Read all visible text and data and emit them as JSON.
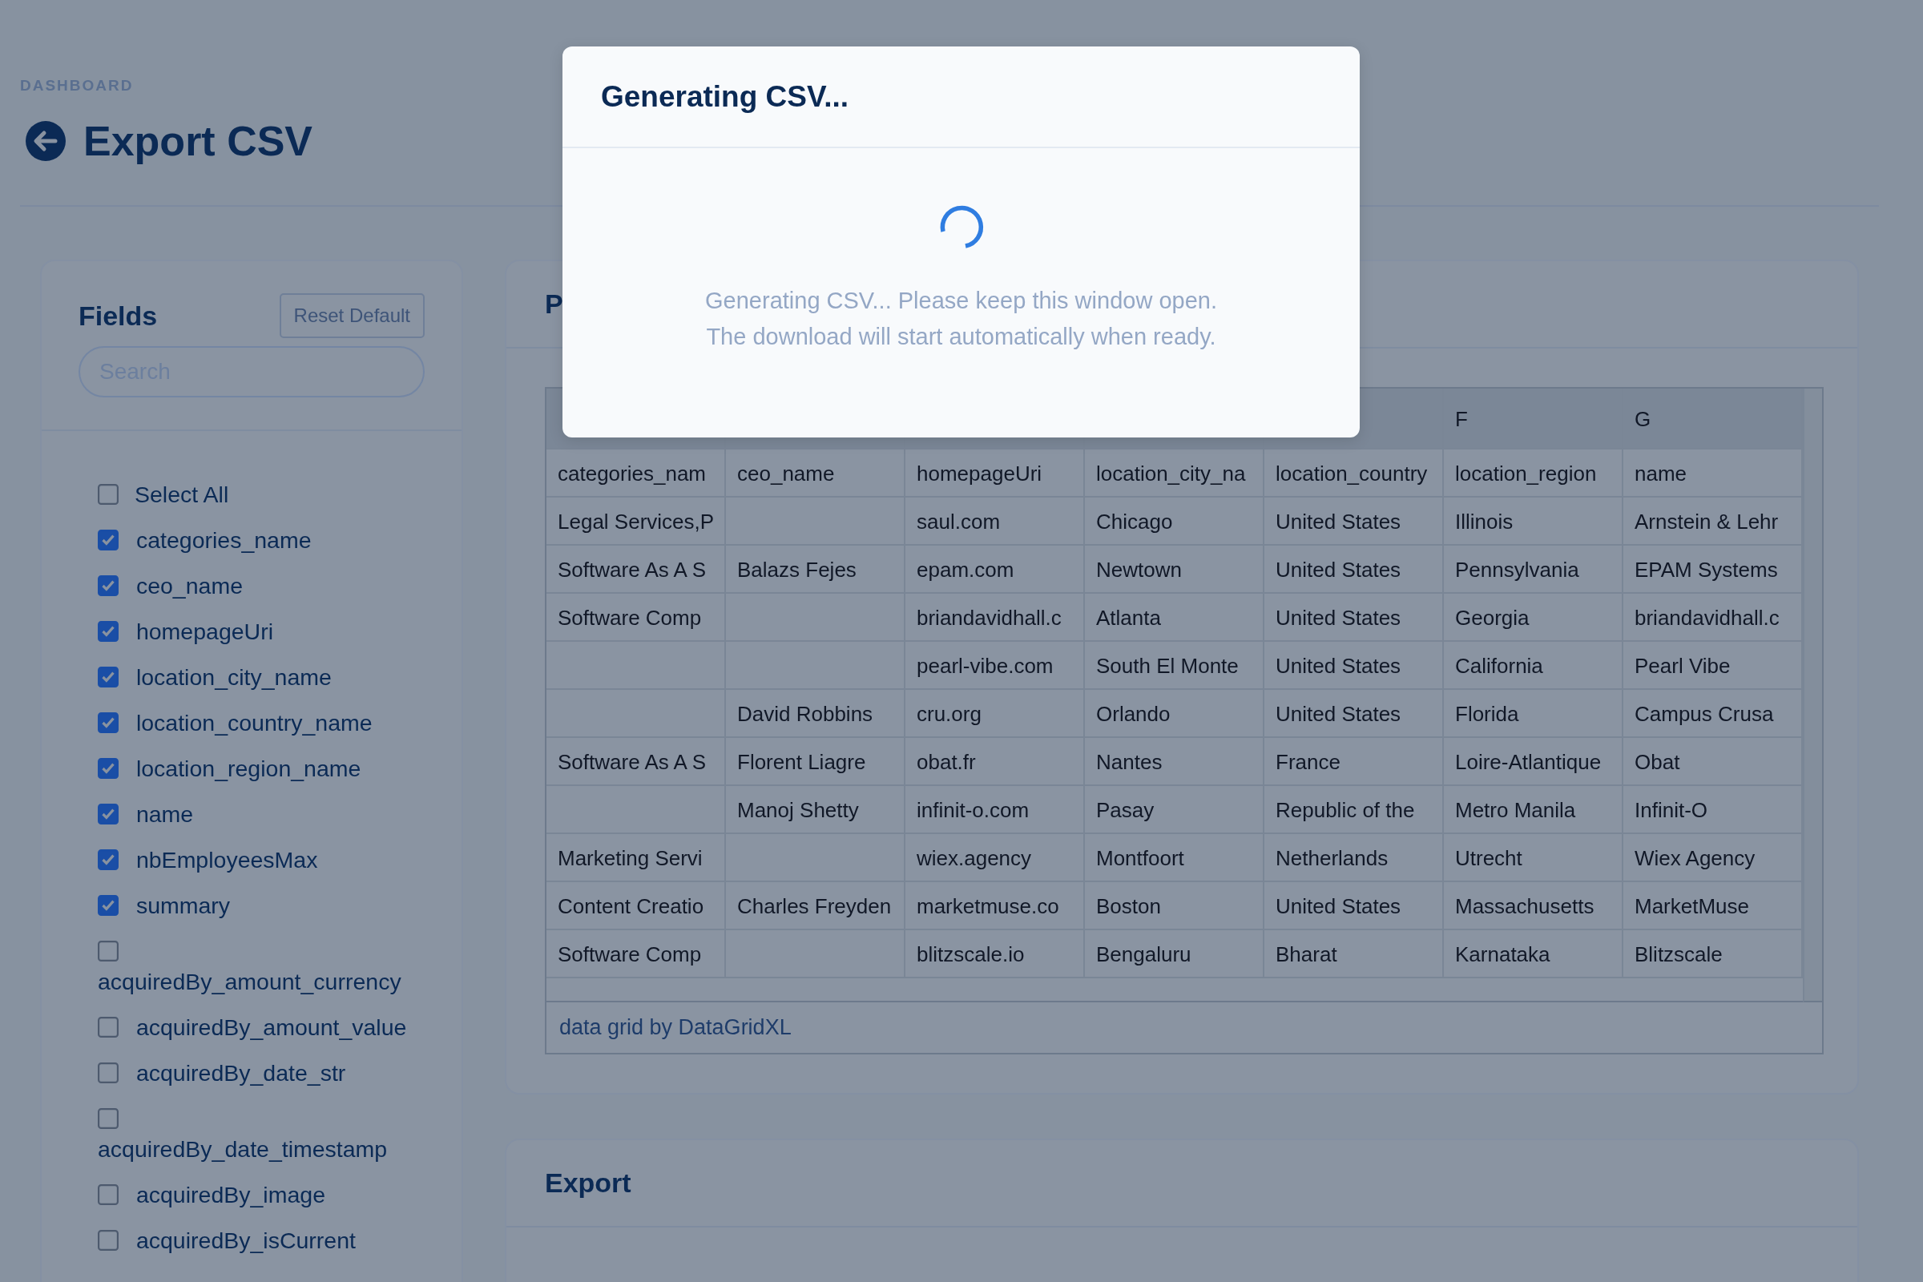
{
  "breadcrumb": "DASHBOARD",
  "title": "Export CSV",
  "fields_panel": {
    "title": "Fields",
    "reset_button": "Reset Default",
    "search": {
      "placeholder": "Search"
    },
    "select_all": {
      "label": "Select All",
      "checked": false
    },
    "items": [
      {
        "label": "categories_name",
        "checked": true
      },
      {
        "label": "ceo_name",
        "checked": true
      },
      {
        "label": "homepageUri",
        "checked": true
      },
      {
        "label": "location_city_name",
        "checked": true
      },
      {
        "label": "location_country_name",
        "checked": true
      },
      {
        "label": "location_region_name",
        "checked": true
      },
      {
        "label": "name",
        "checked": true
      },
      {
        "label": "nbEmployeesMax",
        "checked": true
      },
      {
        "label": "summary",
        "checked": true
      },
      {
        "label": "acquiredBy_amount_currency",
        "checked": false
      },
      {
        "label": "acquiredBy_amount_value",
        "checked": false
      },
      {
        "label": "acquiredBy_date_str",
        "checked": false
      },
      {
        "label": "acquiredBy_date_timestamp",
        "checked": false
      },
      {
        "label": "acquiredBy_image",
        "checked": false
      },
      {
        "label": "acquiredBy_isCurrent",
        "checked": false
      }
    ]
  },
  "preview_panel": {
    "title": "P",
    "grid": {
      "visible_headers": [
        "F",
        "G"
      ],
      "rows": [
        [
          "categories_nam",
          "ceo_name",
          "homepageUri",
          "location_city_na",
          "location_country",
          "location_region",
          "name"
        ],
        [
          "Legal Services,P",
          null,
          "saul.com",
          "Chicago",
          "United States",
          "Illinois",
          "Arnstein & Lehr"
        ],
        [
          "Software As A S",
          "Balazs Fejes",
          "epam.com",
          "Newtown",
          "United States",
          "Pennsylvania",
          "EPAM Systems"
        ],
        [
          "Software Comp",
          null,
          "briandavidhall.c",
          "Atlanta",
          "United States",
          "Georgia",
          "briandavidhall.c"
        ],
        [
          null,
          null,
          "pearl-vibe.com",
          "South El Monte",
          "United States",
          "California",
          "Pearl Vibe"
        ],
        [
          null,
          "David Robbins",
          "cru.org",
          "Orlando",
          "United States",
          "Florida",
          "Campus Crusa"
        ],
        [
          "Software As A S",
          "Florent Liagre",
          "obat.fr",
          "Nantes",
          "France",
          "Loire-Atlantique",
          "Obat"
        ],
        [
          null,
          "Manoj Shetty",
          "infinit-o.com",
          "Pasay",
          "Republic of the",
          "Metro Manila",
          "Infinit-O"
        ],
        [
          "Marketing Servi",
          null,
          "wiex.agency",
          "Montfoort",
          "Netherlands",
          "Utrecht",
          "Wiex Agency"
        ],
        [
          "Content Creatio",
          "Charles Freyden",
          "marketmuse.co",
          "Boston",
          "United States",
          "Massachusetts",
          "MarketMuse"
        ],
        [
          "Software Comp",
          null,
          "blitzscale.io",
          "Bengaluru",
          "Bharat",
          "Karnataka",
          "Blitzscale"
        ]
      ],
      "footer_link": "data grid by DataGridXL"
    }
  },
  "export_panel": {
    "title": "Export"
  },
  "modal": {
    "title": "Generating CSV...",
    "lines": [
      "Generating CSV... Please keep this window open.",
      "The download will start automatically when ready."
    ]
  }
}
